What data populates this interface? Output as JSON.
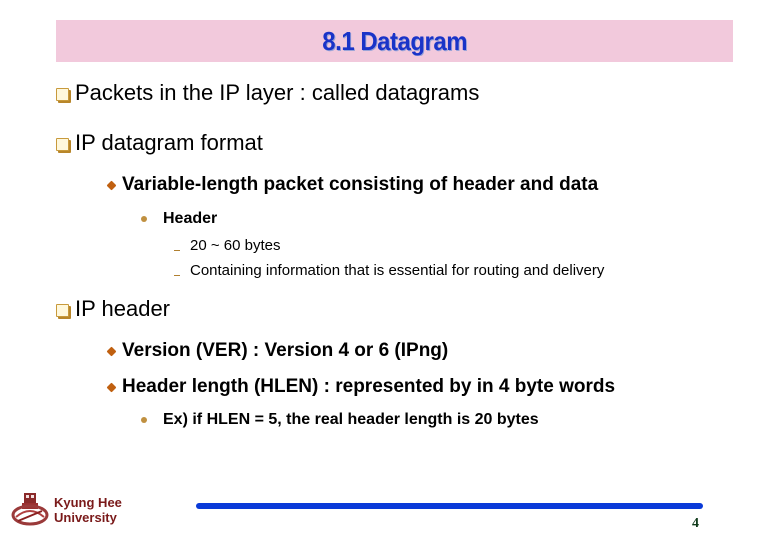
{
  "slide": {
    "title": "8.1 Datagram",
    "bullets": [
      {
        "level": 1,
        "icon": "square-bullet-icon",
        "text": "Packets in the IP layer : called datagrams"
      },
      {
        "level": 1,
        "icon": "square-bullet-icon",
        "text": "IP datagram format"
      },
      {
        "level": 2,
        "icon": "diamond-bullet-icon",
        "text": "Variable-length packet consisting of header and data"
      },
      {
        "level": 3,
        "icon": "dot-bullet-icon",
        "text": "Header"
      },
      {
        "level": 4,
        "icon": "dash-bullet-icon",
        "text": "20 ~ 60 bytes"
      },
      {
        "level": 4,
        "icon": "dash-bullet-icon",
        "text": "Containing information that is essential for routing and delivery"
      },
      {
        "level": 1,
        "icon": "square-bullet-icon",
        "text": "IP header"
      },
      {
        "level": 2,
        "icon": "diamond-bullet-icon",
        "text": "Version (VER) : Version 4 or 6 (IPng)"
      },
      {
        "level": 2,
        "icon": "diamond-bullet-icon",
        "text": "Header length (HLEN) : represented by in 4 byte words"
      },
      {
        "level": 3,
        "icon": "dot-bullet-icon",
        "text": "Ex) if HLEN = 5, the real header length is 20 bytes"
      }
    ]
  },
  "footer": {
    "logo_line1": "Kyung Hee",
    "logo_line2": "University",
    "page_number": "4"
  },
  "colors": {
    "title_bg": "#f2c9dc",
    "title_text": "#1a33c8",
    "footer_bar": "#0a3ad8",
    "logo_text": "#7a1a1a"
  }
}
